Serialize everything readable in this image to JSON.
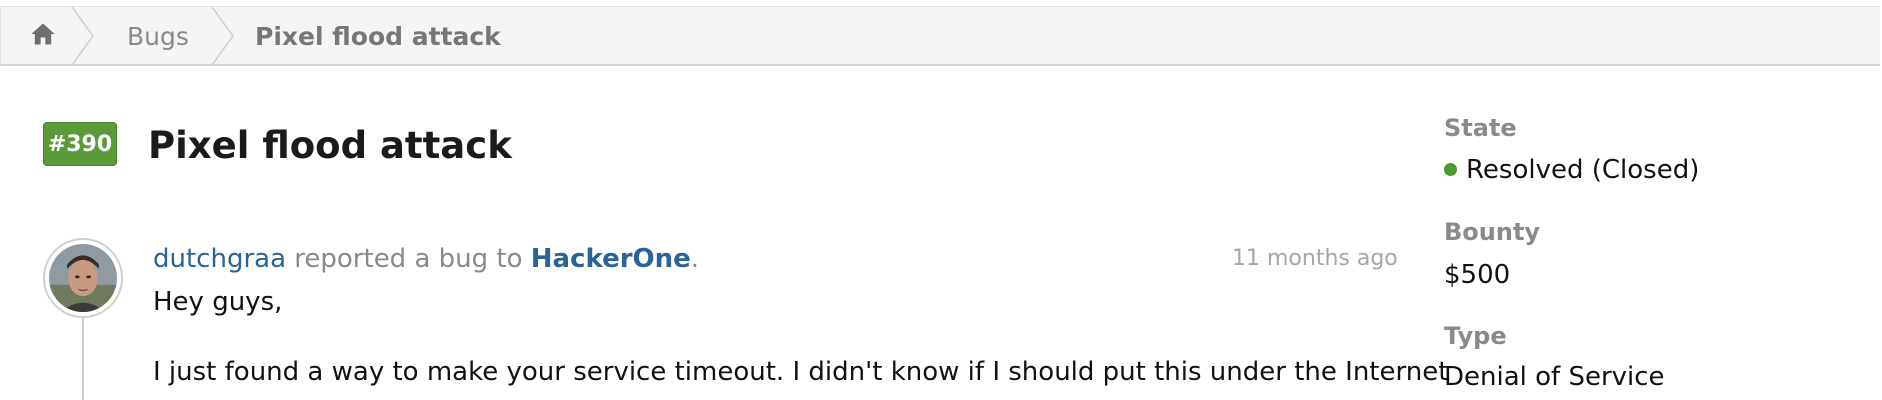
{
  "breadcrumb": {
    "home_icon": "home-icon",
    "bugs_label": "Bugs",
    "current_label": "Pixel flood attack"
  },
  "report": {
    "id_badge": "#390",
    "title": "Pixel flood attack",
    "reporter": "dutchgraa",
    "action_text": "reported a bug to",
    "program": "HackerOne",
    "period": ".",
    "timestamp": "11 months ago",
    "greeting": "Hey guys,",
    "body_line": "I just found a way to make your service timeout. I didn't know if I should put this under the Internet"
  },
  "sidebar": {
    "state_label": "State",
    "state_value": "Resolved (Closed)",
    "bounty_label": "Bounty",
    "bounty_value": "$500",
    "type_label": "Type",
    "type_value": "Denial of Service"
  },
  "colors": {
    "badge": "#5a9a3a",
    "link": "#2a6496",
    "state_dot": "#4a9a2f"
  }
}
